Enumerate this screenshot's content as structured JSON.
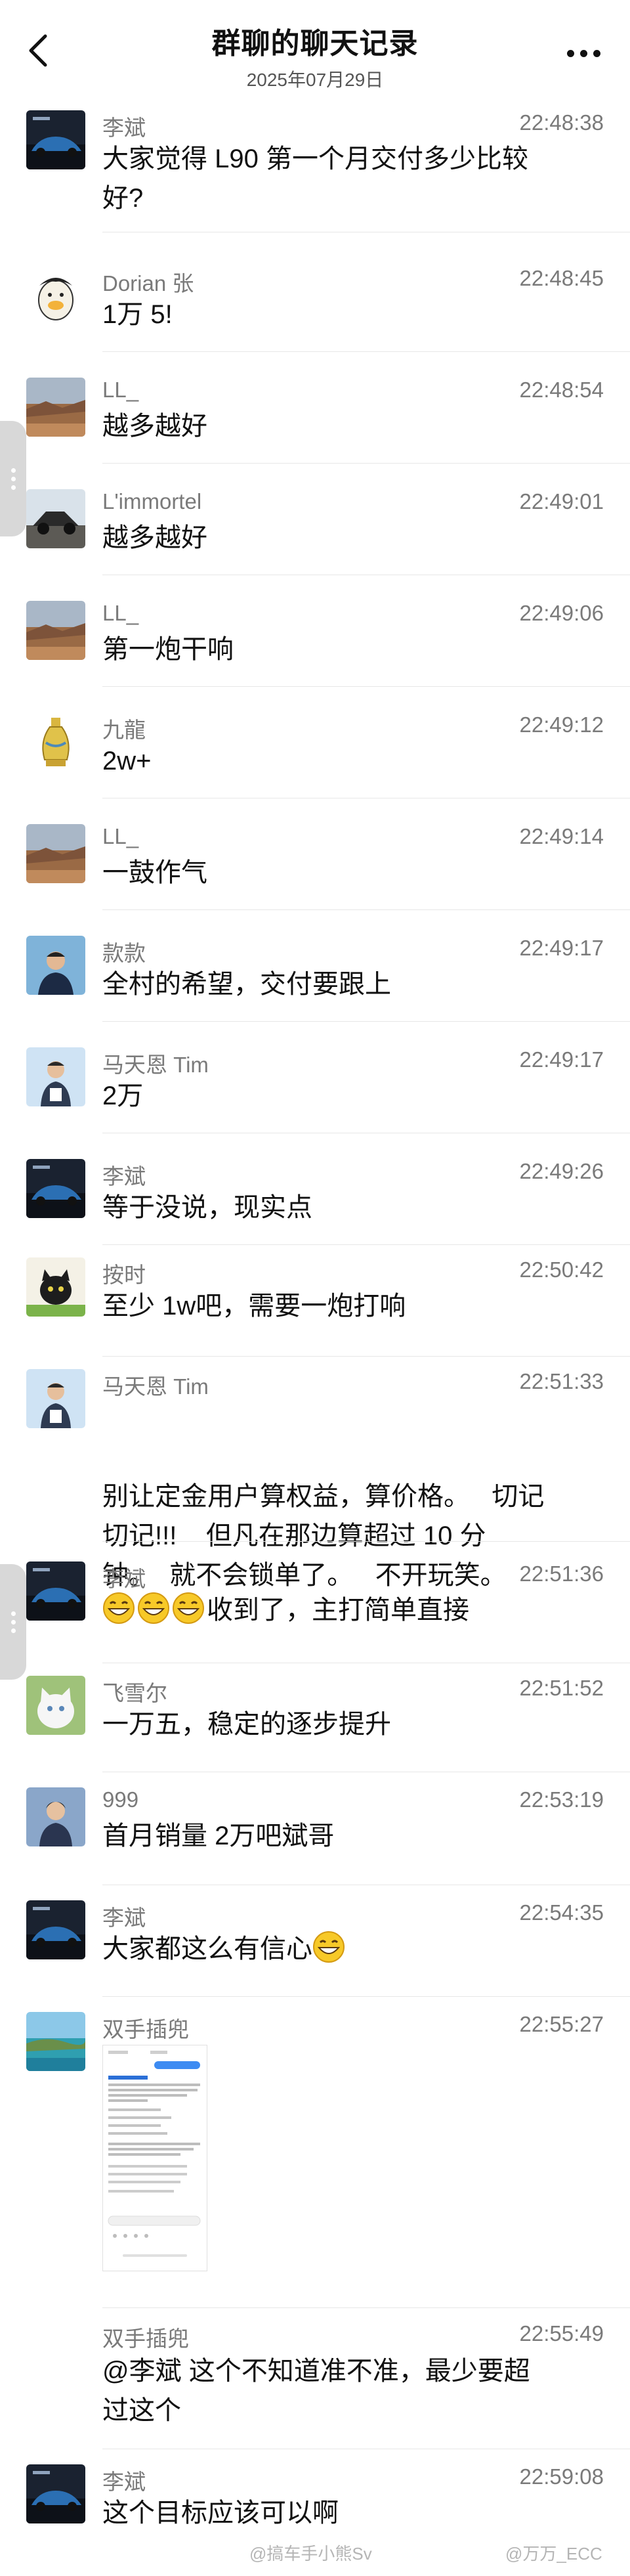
{
  "header": {
    "title": "群聊的聊天记录",
    "date": "2025年07月29日"
  },
  "messages": [
    {
      "sender": "李斌",
      "time": "22:48:38",
      "lines": [
        "大家觉得 L90 第一个月交付多少比较",
        "好?"
      ]
    },
    {
      "sender": "Dorian 张",
      "time": "22:48:45",
      "lines": [
        "1万 5!"
      ]
    },
    {
      "sender": "LL_",
      "time": "22:48:54",
      "lines": [
        "越多越好"
      ]
    },
    {
      "sender": "L'immortel",
      "time": "22:49:01",
      "lines": [
        "越多越好"
      ]
    },
    {
      "sender": "LL_",
      "time": "22:49:06",
      "lines": [
        "第一炮干响"
      ]
    },
    {
      "sender": "九龍",
      "time": "22:49:12",
      "lines": [
        "2w+"
      ]
    },
    {
      "sender": "LL_",
      "time": "22:49:14",
      "lines": [
        "一鼓作气"
      ]
    },
    {
      "sender": "款款",
      "time": "22:49:17",
      "lines": [
        "全村的希望，交付要跟上"
      ]
    },
    {
      "sender": "马天恩 Tim",
      "time": "22:49:17",
      "lines": [
        "2万"
      ]
    },
    {
      "sender": "李斌",
      "time": "22:49:26",
      "lines": [
        "等于没说，现实点"
      ]
    },
    {
      "sender": "按时",
      "time": "22:50:42",
      "lines": [
        "至少 1w吧，需要一炮打响"
      ]
    },
    {
      "sender": "马天恩 Tim",
      "time": "22:51:33",
      "lines": [
        "别让定金用户算权益，算价格。   切记",
        "切记!!!    但凡在那边算超过 10 分",
        "钟。  就不会锁单了。   不开玩笑。"
      ]
    },
    {
      "sender": "李斌",
      "time": "22:51:36",
      "lines": [
        "收到了，主打简单直接"
      ]
    },
    {
      "sender": "飞雪尔",
      "time": "22:51:52",
      "lines": [
        "一万五，稳定的逐步提升"
      ]
    },
    {
      "sender": "999",
      "time": "22:53:19",
      "lines": [
        "首月销量 2万吧斌哥"
      ]
    },
    {
      "sender": "李斌",
      "time": "22:54:35",
      "lines": [
        "大家都这么有信心"
      ]
    },
    {
      "sender": "双手插兜",
      "time": "22:55:27",
      "lines": []
    },
    {
      "sender": "双手插兜",
      "time": "22:55:49",
      "lines": [
        "@李斌 这个不知道准不准，最少要超",
        "过这个"
      ]
    },
    {
      "sender": "李斌",
      "time": "22:59:08",
      "lines": [
        "这个目标应该可以啊"
      ]
    }
  ],
  "icons": {
    "back": "chevron-left-icon",
    "more": "more-dots-icon",
    "emoji": "grinning-face-icon"
  },
  "footer": {
    "watermark_left": "@搞车手小熊Sv",
    "watermark_right": "@万万_ECC"
  }
}
